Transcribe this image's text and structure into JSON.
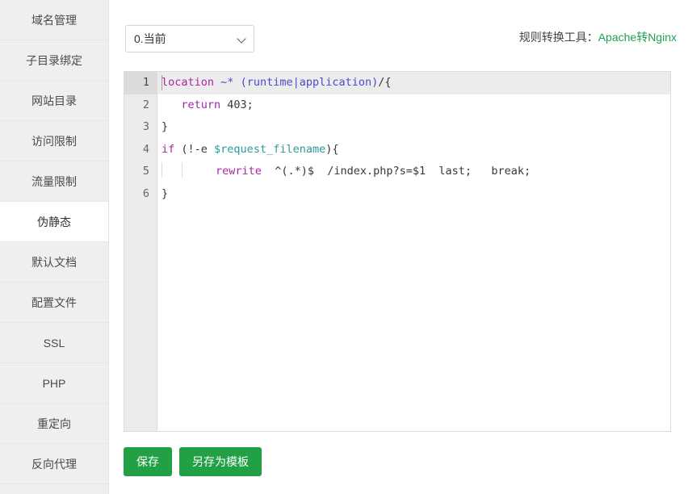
{
  "sidebar": {
    "items": [
      {
        "label": "域名管理",
        "active": false
      },
      {
        "label": "子目录绑定",
        "active": false
      },
      {
        "label": "网站目录",
        "active": false
      },
      {
        "label": "访问限制",
        "active": false
      },
      {
        "label": "流量限制",
        "active": false
      },
      {
        "label": "伪静态",
        "active": true
      },
      {
        "label": "默认文档",
        "active": false
      },
      {
        "label": "配置文件",
        "active": false
      },
      {
        "label": "SSL",
        "active": false
      },
      {
        "label": "PHP",
        "active": false
      },
      {
        "label": "重定向",
        "active": false
      },
      {
        "label": "反向代理",
        "active": false
      }
    ]
  },
  "toolbar": {
    "rule_select": {
      "value": "0.当前",
      "chevron_icon": "chevron-down-icon"
    },
    "converter": {
      "label": "规则转换工具：",
      "link_text": "Apache转Nginx",
      "link_color": "#20a053"
    }
  },
  "editor": {
    "line_numbers": [
      "1",
      "2",
      "3",
      "4",
      "5",
      "6"
    ],
    "active_line": 1,
    "lines": [
      {
        "number": "1",
        "text": "location ~* (runtime|application)/{",
        "tokens": [
          {
            "t": "location",
            "c": "kw"
          },
          {
            "t": " ",
            "c": "txt"
          },
          {
            "t": "~*",
            "c": "op"
          },
          {
            "t": " ",
            "c": "txt"
          },
          {
            "t": "(runtime|application)",
            "c": "op"
          },
          {
            "t": "/{",
            "c": "txt"
          }
        ]
      },
      {
        "number": "2",
        "text": "   return 403;",
        "tokens": [
          {
            "t": "   ",
            "c": "txt"
          },
          {
            "t": "return",
            "c": "kw"
          },
          {
            "t": " 403;",
            "c": "txt"
          }
        ]
      },
      {
        "number": "3",
        "text": "}",
        "tokens": [
          {
            "t": "}",
            "c": "txt"
          }
        ]
      },
      {
        "number": "4",
        "text": "if (!-e $request_filename){",
        "tokens": [
          {
            "t": "if",
            "c": "kw"
          },
          {
            "t": " (!-e ",
            "c": "txt"
          },
          {
            "t": "$request_filename",
            "c": "var"
          },
          {
            "t": "){",
            "c": "txt"
          }
        ]
      },
      {
        "number": "5",
        "text": "      rewrite  ^(.*)$  /index.php?s=$1  last;   break;",
        "tokens": [
          {
            "t": "rewrite",
            "c": "kw"
          },
          {
            "t": "  ^(.*)$  /index.php?s=$1  last;   break;",
            "c": "txt"
          }
        ]
      },
      {
        "number": "6",
        "text": "}",
        "tokens": [
          {
            "t": "}",
            "c": "txt"
          }
        ]
      }
    ]
  },
  "buttons": {
    "save": "保存",
    "save_as_template": "另存为模板",
    "color": "#22a046"
  }
}
